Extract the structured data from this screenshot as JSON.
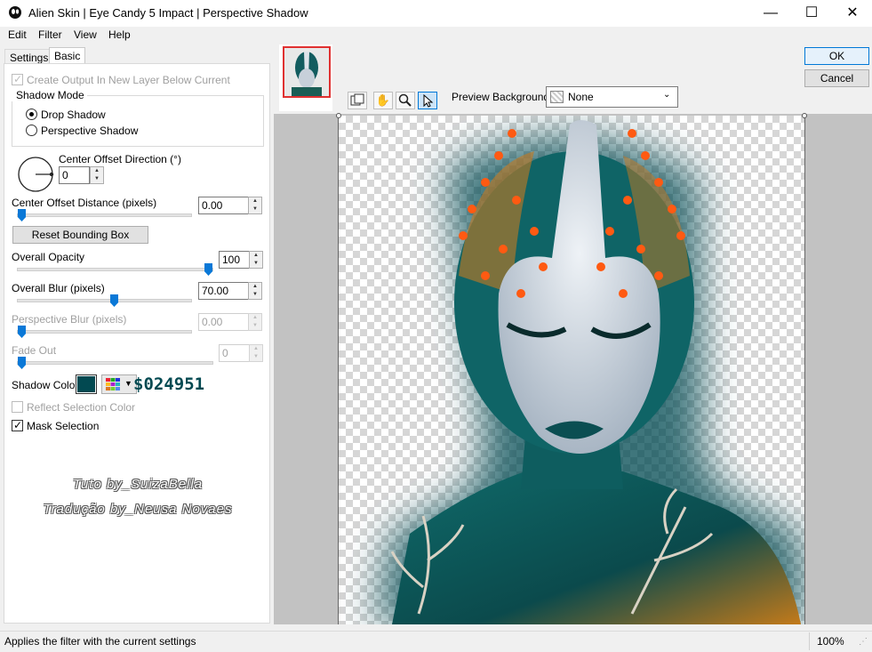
{
  "window": {
    "title": "Alien Skin | Eye Candy 5 Impact | Perspective Shadow",
    "min_glyph": "—",
    "max_glyph": "☐",
    "close_glyph": "✕"
  },
  "menu": [
    "Edit",
    "Filter",
    "View",
    "Help"
  ],
  "tabs": [
    {
      "label": "Settings",
      "active": false
    },
    {
      "label": "Basic",
      "active": true
    }
  ],
  "basic": {
    "create_output_label": "Create Output In New Layer Below Current",
    "create_output_checked": true,
    "shadow_mode_label": "Shadow Mode",
    "shadow_modes": [
      {
        "label": "Drop Shadow",
        "selected": true
      },
      {
        "label": "Perspective Shadow",
        "selected": false
      }
    ],
    "center_offset_direction": {
      "label": "Center Offset Direction (°)",
      "value": "0"
    },
    "center_offset_distance": {
      "label": "Center Offset Distance (pixels)",
      "value": "0.00",
      "slider": 0.0
    },
    "reset_bounding_box_label": "Reset Bounding Box",
    "overall_opacity": {
      "label": "Overall Opacity",
      "value": "100",
      "slider": 1.0
    },
    "overall_blur": {
      "label": "Overall Blur (pixels)",
      "value": "70.00",
      "slider": 0.55
    },
    "perspective_blur": {
      "label": "Perspective Blur (pixels)",
      "value": "0.00",
      "slider": 0.0
    },
    "fade_out": {
      "label": "Fade Out",
      "value": "0",
      "slider": 0.0
    },
    "shadow_color_label": "Shadow Color",
    "shadow_color": "#024951",
    "shadow_color_hex_text": "$024951",
    "reflect_selection_label": "Reflect Selection Color",
    "reflect_selection_checked": false,
    "mask_selection_label": "Mask Selection",
    "mask_selection_checked": true
  },
  "watermark": {
    "line1": "Tuto by_SuizaBella",
    "line2": "Tradução by_Neusa Novaes"
  },
  "buttons": {
    "ok": "OK",
    "cancel": "Cancel"
  },
  "toolbar_icons": [
    "toggle-preview-icon",
    "hand-pan-icon",
    "zoom-icon",
    "select-arrow-icon"
  ],
  "preview_background": {
    "label": "Preview Background:",
    "value": "None"
  },
  "statusbar": {
    "text": "Applies the filter with the current settings",
    "zoom": "100%"
  },
  "accent_colors": {
    "slider": "#0a78d7",
    "ok_border": "#0078d7"
  }
}
